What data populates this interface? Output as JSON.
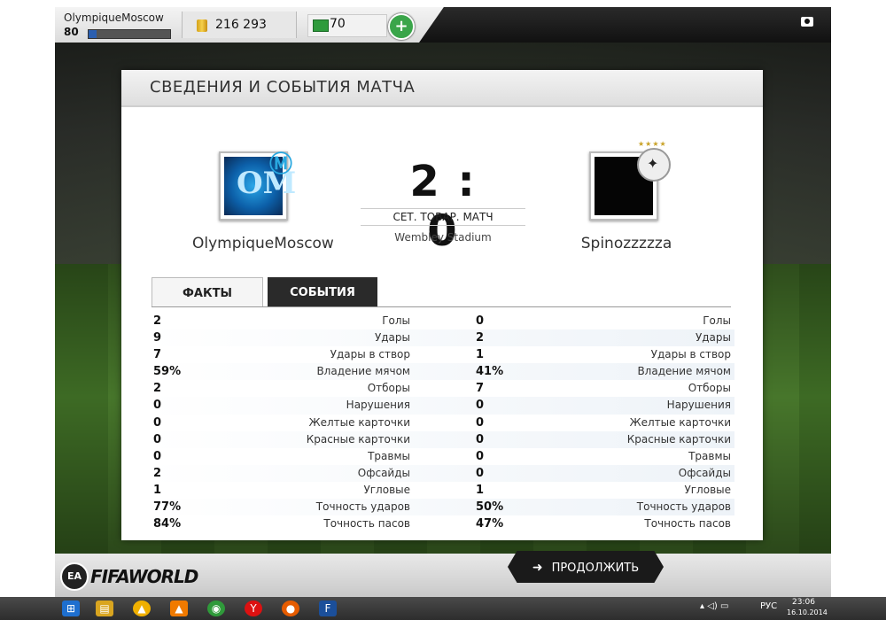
{
  "user": {
    "name": "OlympiqueMoscow",
    "level": "80",
    "level_progress": 0.1
  },
  "currency": {
    "coins": "216 293",
    "points": "70",
    "plus": "+"
  },
  "panel": {
    "title": "СВЕДЕНИЯ И СОБЫТИЯ МАТЧА"
  },
  "match": {
    "home_team": "OlympiqueMoscow",
    "away_team": "Spinozzzzza",
    "score": "2 : 0",
    "type": "СЕТ. ТОВАР. МАТЧ",
    "stadium": "Wembley Stadium"
  },
  "tabs": {
    "facts": "ФАКТЫ",
    "events": "СОБЫТИЯ"
  },
  "stats": [
    {
      "home": "2",
      "away": "0",
      "label": "Голы"
    },
    {
      "home": "9",
      "away": "2",
      "label": "Удары"
    },
    {
      "home": "7",
      "away": "1",
      "label": "Удары в створ"
    },
    {
      "home": "59%",
      "away": "41%",
      "label": "Владение мячом"
    },
    {
      "home": "2",
      "away": "7",
      "label": "Отборы"
    },
    {
      "home": "0",
      "away": "0",
      "label": "Нарушения"
    },
    {
      "home": "0",
      "away": "0",
      "label": "Желтые карточки"
    },
    {
      "home": "0",
      "away": "0",
      "label": "Красные карточки"
    },
    {
      "home": "0",
      "away": "0",
      "label": "Травмы"
    },
    {
      "home": "2",
      "away": "0",
      "label": "Офсайды"
    },
    {
      "home": "1",
      "away": "1",
      "label": "Угловые"
    },
    {
      "home": "77%",
      "away": "50%",
      "label": "Точность ударов"
    },
    {
      "home": "84%",
      "away": "47%",
      "label": "Точность пасов"
    }
  ],
  "footer": {
    "continue": "ПРОДОЛЖИТЬ",
    "logo": "FIFAWORLD",
    "ea": "EA"
  },
  "taskbar": {
    "lang": "РУС",
    "time": "23:06",
    "date": "16.10.2014"
  },
  "icons": [
    "coin-icon",
    "points-icon",
    "plus-icon",
    "camera-icon",
    "arrow-right-icon",
    "windows-icon"
  ],
  "colors": {
    "accent_green": "#3aa54a",
    "dark": "#1a1a1a",
    "level_blue": "#2b5fb0"
  }
}
